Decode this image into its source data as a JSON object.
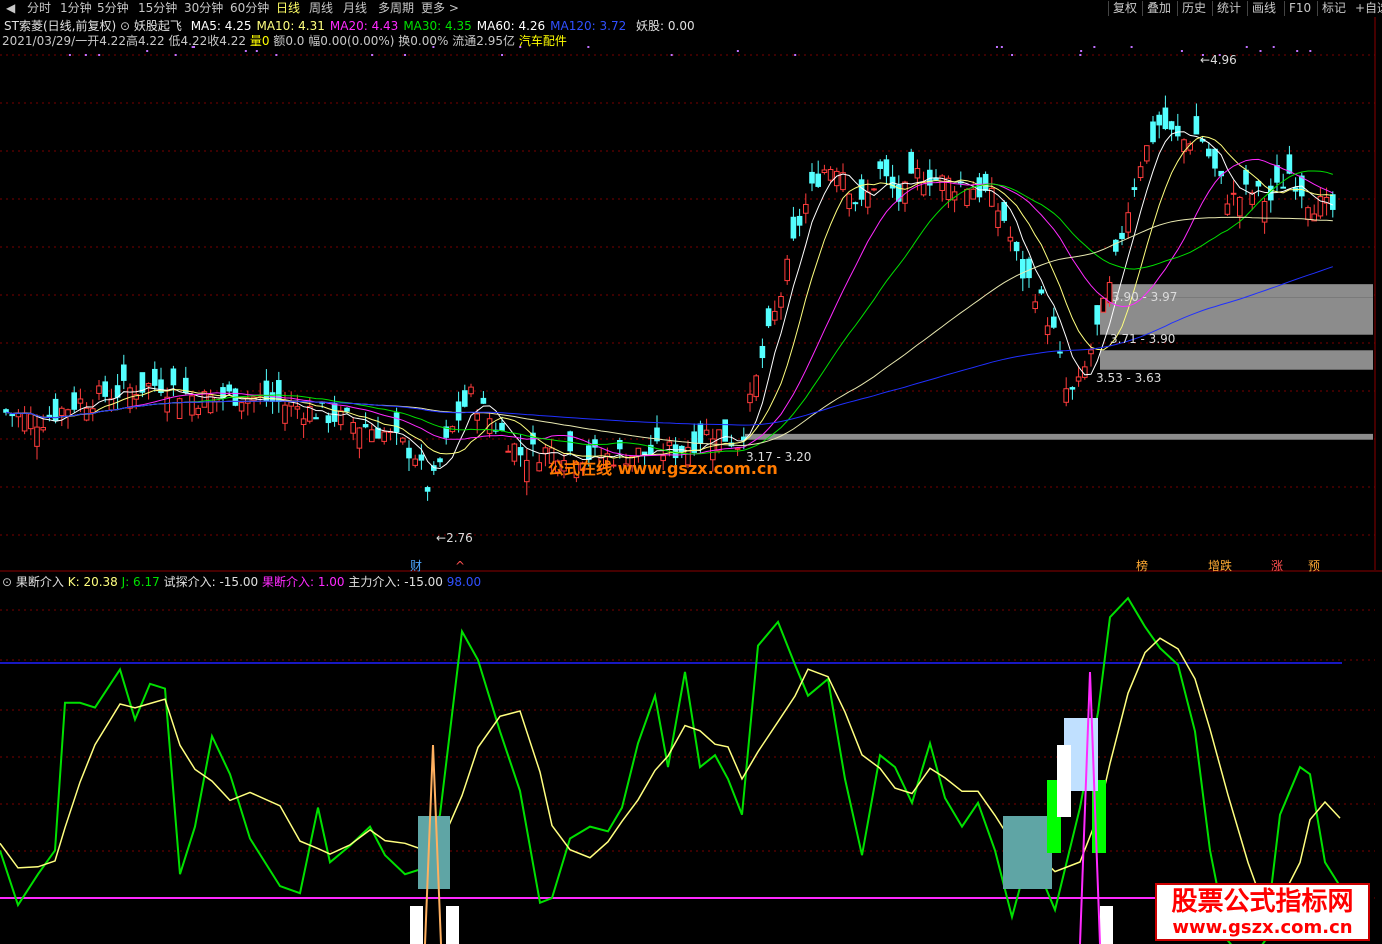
{
  "toolbar": {
    "left_tabs": [
      "分时",
      "1分钟",
      "5分钟",
      "15分钟",
      "30分钟",
      "60分钟",
      "日线",
      "周线",
      "月线",
      "多周期",
      "更多 >"
    ],
    "active_tab": "日线",
    "right_buttons": [
      "复权",
      "叠加",
      "历史",
      "统计",
      "画线",
      "F10",
      "标记"
    ],
    "self_select": "+自选",
    "nav_icon": "diamond-icon",
    "close_icon": "close-icon"
  },
  "header": {
    "stock_name": "ST索菱(日线,前复权)",
    "indicator_name": "妖股起飞",
    "ma_values": [
      {
        "label": "MA5: 4.25",
        "color": "#ffffff"
      },
      {
        "label": "MA10: 4.31",
        "color": "#ffff7f"
      },
      {
        "label": "MA20: 4.43",
        "color": "#ff2aff"
      },
      {
        "label": "MA30: 4.35",
        "color": "#00e000"
      },
      {
        "label": "MA60: 4.26",
        "color": "#ffffff"
      },
      {
        "label": "MA120: 3.72",
        "color": "#3050ff"
      }
    ],
    "yao_gu": "妖股: 0.00",
    "quote_line": {
      "date": "2021/03/29/一",
      "open_label": "开",
      "open": "4.22",
      "high_label": "高",
      "high": "4.22",
      "low_label": "低",
      "low": "4.22",
      "close_label": "收",
      "close": "4.22",
      "vol_label": "量",
      "vol": "0",
      "amt_label": "额",
      "amt": "0.0",
      "range_label": "幅",
      "range": "0.00(0.00%)",
      "turnover_label": "换",
      "turnover": "0.00%",
      "float_label": "流通",
      "float": "2.95亿",
      "sector": "汽车配件"
    }
  },
  "main_chart": {
    "y_range": [
      2.5,
      5.2
    ],
    "high_marker": "4.96",
    "low_marker": "2.76",
    "zones": [
      {
        "label": "3.90 - 3.97",
        "lo": 3.9,
        "hi": 3.97
      },
      {
        "label": "3.71 - 3.90",
        "lo": 3.71,
        "hi": 3.9
      },
      {
        "label": "3.53 - 3.63",
        "lo": 3.53,
        "hi": 3.63
      },
      {
        "label": "3.17 - 3.20",
        "lo": 3.17,
        "hi": 3.2
      }
    ],
    "watermark": "公式在线 www.gszx.com.cn",
    "event_tags": [
      {
        "text": "财",
        "color": "#4da6ff"
      },
      {
        "text": "^",
        "color": "#ff5050"
      },
      {
        "text": "榜",
        "color": "#ffaa33"
      },
      {
        "text": "增跌",
        "color": "#ffaa33"
      },
      {
        "text": "涨",
        "color": "#ff5050"
      },
      {
        "text": "预",
        "color": "#ffaa33"
      }
    ]
  },
  "sub_chart": {
    "title": "果断介入",
    "k": "K: 20.38",
    "j": "J: 6.17",
    "trial": "试探介入: -15.00",
    "decisive": "果断介入: 1.00",
    "main_force": "主力介入: -15.00",
    "level": "98.00",
    "colors": {
      "k": "#ffff7f",
      "j": "#00e000",
      "level_line": "#2020ff",
      "zero_line": "#ff2aff"
    }
  },
  "brand_badge": {
    "title": "股票公式指标网",
    "url": "www.gszx.com.cn"
  },
  "colors": {
    "up": "#ff3c3c",
    "down": "#54ffff",
    "grid": "#7a0000",
    "zone": "#8c8c8c"
  }
}
